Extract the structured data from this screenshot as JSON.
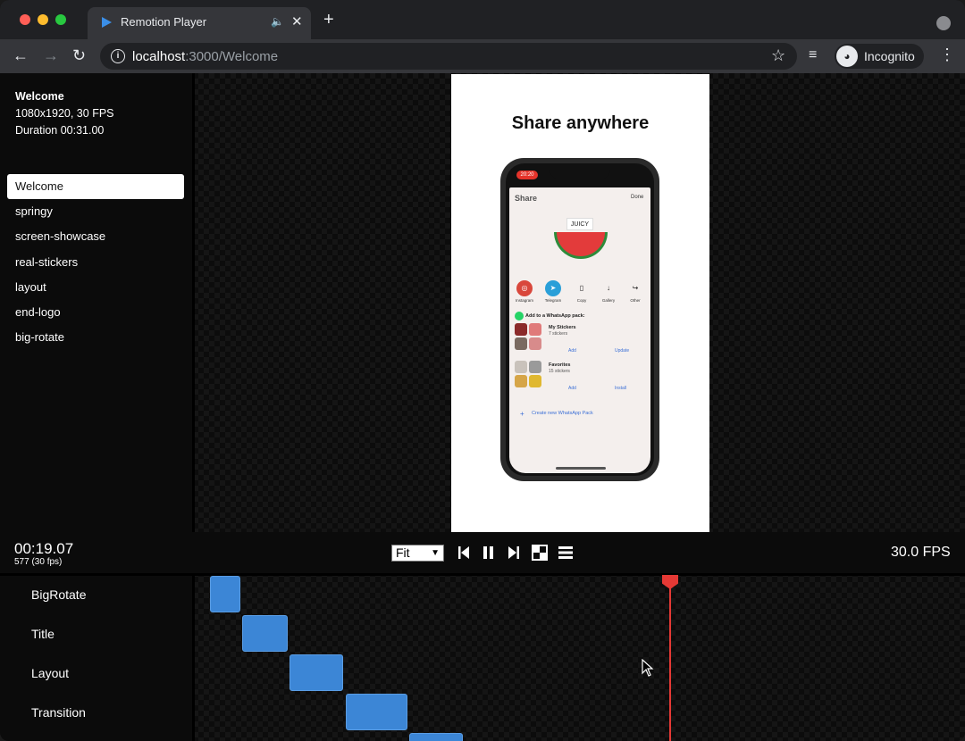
{
  "browser": {
    "tab_title": "Remotion Player",
    "url_host": "localhost",
    "url_rest": ":3000/Welcome",
    "profile_label": "Incognito"
  },
  "composition": {
    "name": "Welcome",
    "resolution_fps": "1080x1920, 30 FPS",
    "duration": "Duration 00:31.00"
  },
  "compositions": [
    {
      "label": "Welcome",
      "active": true
    },
    {
      "label": "springy",
      "active": false
    },
    {
      "label": "screen-showcase",
      "active": false
    },
    {
      "label": "real-stickers",
      "active": false
    },
    {
      "label": "layout",
      "active": false
    },
    {
      "label": "end-logo",
      "active": false
    },
    {
      "label": "big-rotate",
      "active": false
    }
  ],
  "preview": {
    "headline": "Share anywhere",
    "phone": {
      "status_time": "20:20",
      "share_title": "Share",
      "done_label": "Done",
      "sticker_label": "JUICY",
      "apps": [
        {
          "label": "Instagram",
          "color": "#d9473b",
          "glyph": "◎"
        },
        {
          "label": "Telegram",
          "color": "#2a9fd8",
          "glyph": "➤"
        },
        {
          "label": "Copy",
          "color": "#f4efed",
          "glyph": "▯"
        },
        {
          "label": "Gallery",
          "color": "#f4efed",
          "glyph": "↓"
        },
        {
          "label": "Other",
          "color": "#f4efed",
          "glyph": "↪"
        }
      ],
      "section_label": "Add to a WhatsApp pack:",
      "packs": [
        {
          "title": "My Stickers",
          "subtitle": "7 stickers",
          "add": "Add",
          "action": "Update"
        },
        {
          "title": "Favorites",
          "subtitle": "15 stickers",
          "add": "Add",
          "action": "Install"
        }
      ],
      "create_label": "Create new WhatsApp Pack"
    }
  },
  "controls": {
    "time": "00:19.07",
    "frame": "577 (30 fps)",
    "zoom": "Fit",
    "fps": "30.0 FPS"
  },
  "timeline": {
    "tracks": [
      "BigRotate",
      "Title",
      "Layout",
      "Transition"
    ],
    "playhead_frame": 577,
    "block_color": "#3c86d6",
    "playhead_color": "#e53935"
  }
}
